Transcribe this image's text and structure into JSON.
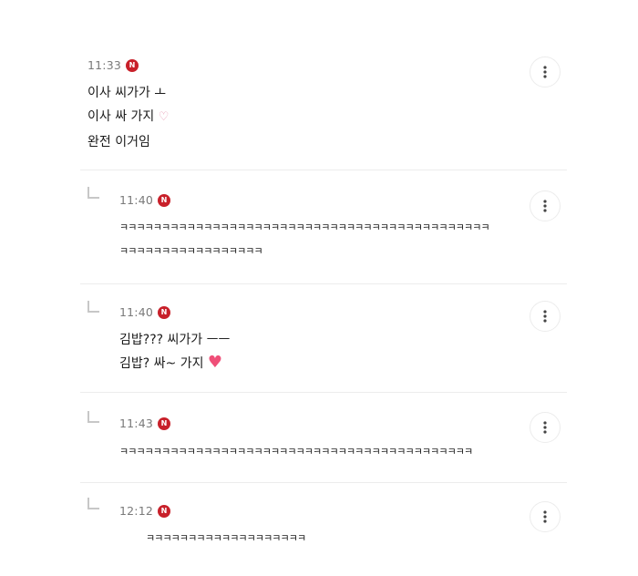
{
  "comments": [
    {
      "time": "11:33",
      "badge": "N",
      "lines": [
        "이사 씨가가 ㅗ",
        "이사 싸 가지",
        "완전 이거임"
      ],
      "emoji": "♡"
    },
    {
      "time": "11:40",
      "badge": "N",
      "lines": [
        "ㅋㅋㅋㅋㅋㅋㅋㅋㅋㅋㅋㅋㅋㅋㅋㅋㅋㅋㅋㅋㅋㅋㅋㅋㅋㅋㅋㅋㅋㅋㅋㅋㅋㅋㅋㅋㅋㅋㅋㅋㅋㅋㅋㅋ",
        "ㅋㅋㅋㅋㅋㅋㅋㅋㅋㅋㅋㅋㅋㅋㅋㅋㅋ"
      ]
    },
    {
      "time": "11:40",
      "badge": "N",
      "lines": [
        "김밥??? 씨가가 ㅡㅡ",
        "김밥? 싸~ 가지"
      ],
      "emoji": "♥"
    },
    {
      "time": "11:43",
      "badge": "N",
      "lines": [
        "ㅋㅋㅋㅋㅋㅋㅋㅋㅋㅋㅋㅋㅋㅋㅋㅋㅋㅋㅋㅋㅋㅋㅋㅋㅋㅋㅋㅋㅋㅋㅋㅋㅋㅋㅋㅋㅋㅋㅋㅋㅋㅋ"
      ]
    },
    {
      "time": "12:12",
      "badge": "N",
      "lines": [
        "ㅋㅋㅋㅋㅋㅋㅋㅋㅋㅋㅋㅋㅋㅋㅋㅋㅋㅋㅋ"
      ]
    }
  ],
  "icons": {
    "more": "more-vertical-icon",
    "reply": "reply-arrow-icon",
    "badge_color": "#c8202a"
  }
}
